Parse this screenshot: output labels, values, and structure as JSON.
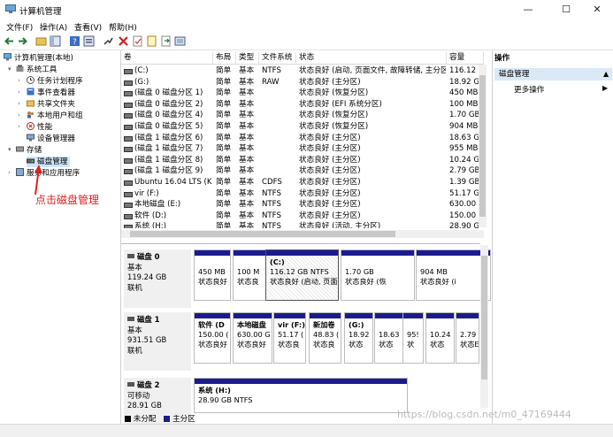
{
  "window": {
    "title": "计算机管理",
    "min": "—",
    "max": "☐",
    "close": "✕"
  },
  "menu": [
    "文件(F)",
    "操作(A)",
    "查看(V)",
    "帮助(H)"
  ],
  "tree": {
    "root": "计算机管理(本地)",
    "system_tools": "系统工具",
    "task_scheduler": "任务计划程序",
    "event_viewer": "事件查看器",
    "shared_folders": "共享文件夹",
    "local_users": "本地用户和组",
    "performance": "性能",
    "device_manager": "设备管理器",
    "storage": "存储",
    "disk_management": "磁盘管理",
    "services": "服务和应用程序"
  },
  "annotation": "点击磁盘管理",
  "columns": [
    "卷",
    "布局",
    "类型",
    "文件系统",
    "状态",
    "容量"
  ],
  "volumes": [
    {
      "name": "(C:)",
      "layout": "简单",
      "type": "基本",
      "fs": "NTFS",
      "status": "状态良好 (启动, 页面文件, 故障转储, 主分区)",
      "size": "116.12 C"
    },
    {
      "name": "(G:)",
      "layout": "简单",
      "type": "基本",
      "fs": "RAW",
      "status": "状态良好 (主分区)",
      "size": "18.92 GB"
    },
    {
      "name": "(磁盘 0 磁盘分区 1)",
      "layout": "简单",
      "type": "基本",
      "fs": "",
      "status": "状态良好 (恢复分区)",
      "size": "450 MB"
    },
    {
      "name": "(磁盘 0 磁盘分区 2)",
      "layout": "简单",
      "type": "基本",
      "fs": "",
      "status": "状态良好 (EFI 系统分区)",
      "size": "100 MB"
    },
    {
      "name": "(磁盘 0 磁盘分区 4)",
      "layout": "简单",
      "type": "基本",
      "fs": "",
      "status": "状态良好 (恢复分区)",
      "size": "1.70 GB"
    },
    {
      "name": "(磁盘 0 磁盘分区 5)",
      "layout": "简单",
      "type": "基本",
      "fs": "",
      "status": "状态良好 (恢复分区)",
      "size": "904 MB"
    },
    {
      "name": "(磁盘 1 磁盘分区 6)",
      "layout": "简单",
      "type": "基本",
      "fs": "",
      "status": "状态良好 (主分区)",
      "size": "18.63 GB"
    },
    {
      "name": "(磁盘 1 磁盘分区 7)",
      "layout": "简单",
      "type": "基本",
      "fs": "",
      "status": "状态良好 (主分区)",
      "size": "955 MB"
    },
    {
      "name": "(磁盘 1 磁盘分区 8)",
      "layout": "简单",
      "type": "基本",
      "fs": "",
      "status": "状态良好 (主分区)",
      "size": "10.24 GB"
    },
    {
      "name": "(磁盘 1 磁盘分区 9)",
      "layout": "简单",
      "type": "基本",
      "fs": "",
      "status": "状态良好 (主分区)",
      "size": "2.79 GB"
    },
    {
      "name": "Ubuntu 16.04 LTS (K:)",
      "layout": "简单",
      "type": "基本",
      "fs": "CDFS",
      "status": "状态良好 (主分区)",
      "size": "1.39 GB"
    },
    {
      "name": "vir (F:)",
      "layout": "简单",
      "type": "基本",
      "fs": "NTFS",
      "status": "状态良好 (主分区)",
      "size": "51.17 GB"
    },
    {
      "name": "本地磁盘 (E:)",
      "layout": "简单",
      "type": "基本",
      "fs": "NTFS",
      "status": "状态良好 (主分区)",
      "size": "630.00 G"
    },
    {
      "name": "软件 (D:)",
      "layout": "简单",
      "type": "基本",
      "fs": "NTFS",
      "status": "状态良好 (主分区)",
      "size": "150.00 C"
    },
    {
      "name": "系统 (H:)",
      "layout": "简单",
      "type": "基本",
      "fs": "NTFS",
      "status": "状态良好 (活动, 主分区)",
      "size": "28.90 GB"
    }
  ],
  "disks": [
    {
      "name": "磁盘 0",
      "type": "基本",
      "size": "119.24 GB",
      "state": "联机",
      "parts": [
        {
          "l1": "",
          "l2": "450 MB",
          "l3": "状态良好"
        },
        {
          "l1": "",
          "l2": "100 M",
          "l3": "状态良"
        },
        {
          "l1": "(C:)",
          "l2": "116.12 GB NTFS",
          "l3": "状态良好 (启动, 页面"
        },
        {
          "l1": "",
          "l2": "1.70 GB",
          "l3": "状态良好 (恢"
        },
        {
          "l1": "",
          "l2": "904 MB",
          "l3": "状态良好 (i"
        }
      ]
    },
    {
      "name": "磁盘 1",
      "type": "基本",
      "size": "931.51 GB",
      "state": "联机",
      "parts": [
        {
          "l1": "软件 (D",
          "l2": "150.00 (",
          "l3": "状态良好"
        },
        {
          "l1": "本地磁盘",
          "l2": "630.00 G",
          "l3": "状态良好"
        },
        {
          "l1": "vir (F:)",
          "l2": "51.17 (",
          "l3": "状态良"
        },
        {
          "l1": "新加卷",
          "l2": "48.83 (",
          "l3": "状态良"
        },
        {
          "l1": "(G:)",
          "l2": "18.92",
          "l3": "状态"
        },
        {
          "l1": "",
          "l2": "18.63",
          "l3": "状态"
        },
        {
          "l1": "",
          "l2": "95!",
          "l3": "状"
        },
        {
          "l1": "",
          "l2": "10.24",
          "l3": "状态"
        },
        {
          "l1": "",
          "l2": "2.79 (",
          "l3": "状态E"
        }
      ]
    },
    {
      "name": "磁盘 2",
      "type": "可移动",
      "size": "28.91 GB",
      "state": "",
      "parts": [
        {
          "l1": "系统 (H:)",
          "l2": "28.90 GB NTFS",
          "l3": ""
        }
      ]
    }
  ],
  "legend": {
    "unallocated": "未分配",
    "primary": "主分区"
  },
  "actions": {
    "header": "操作",
    "selected": "磁盘管理",
    "more": "更多操作"
  },
  "watermark": "https://blog.csdn.net/m0_47169444"
}
